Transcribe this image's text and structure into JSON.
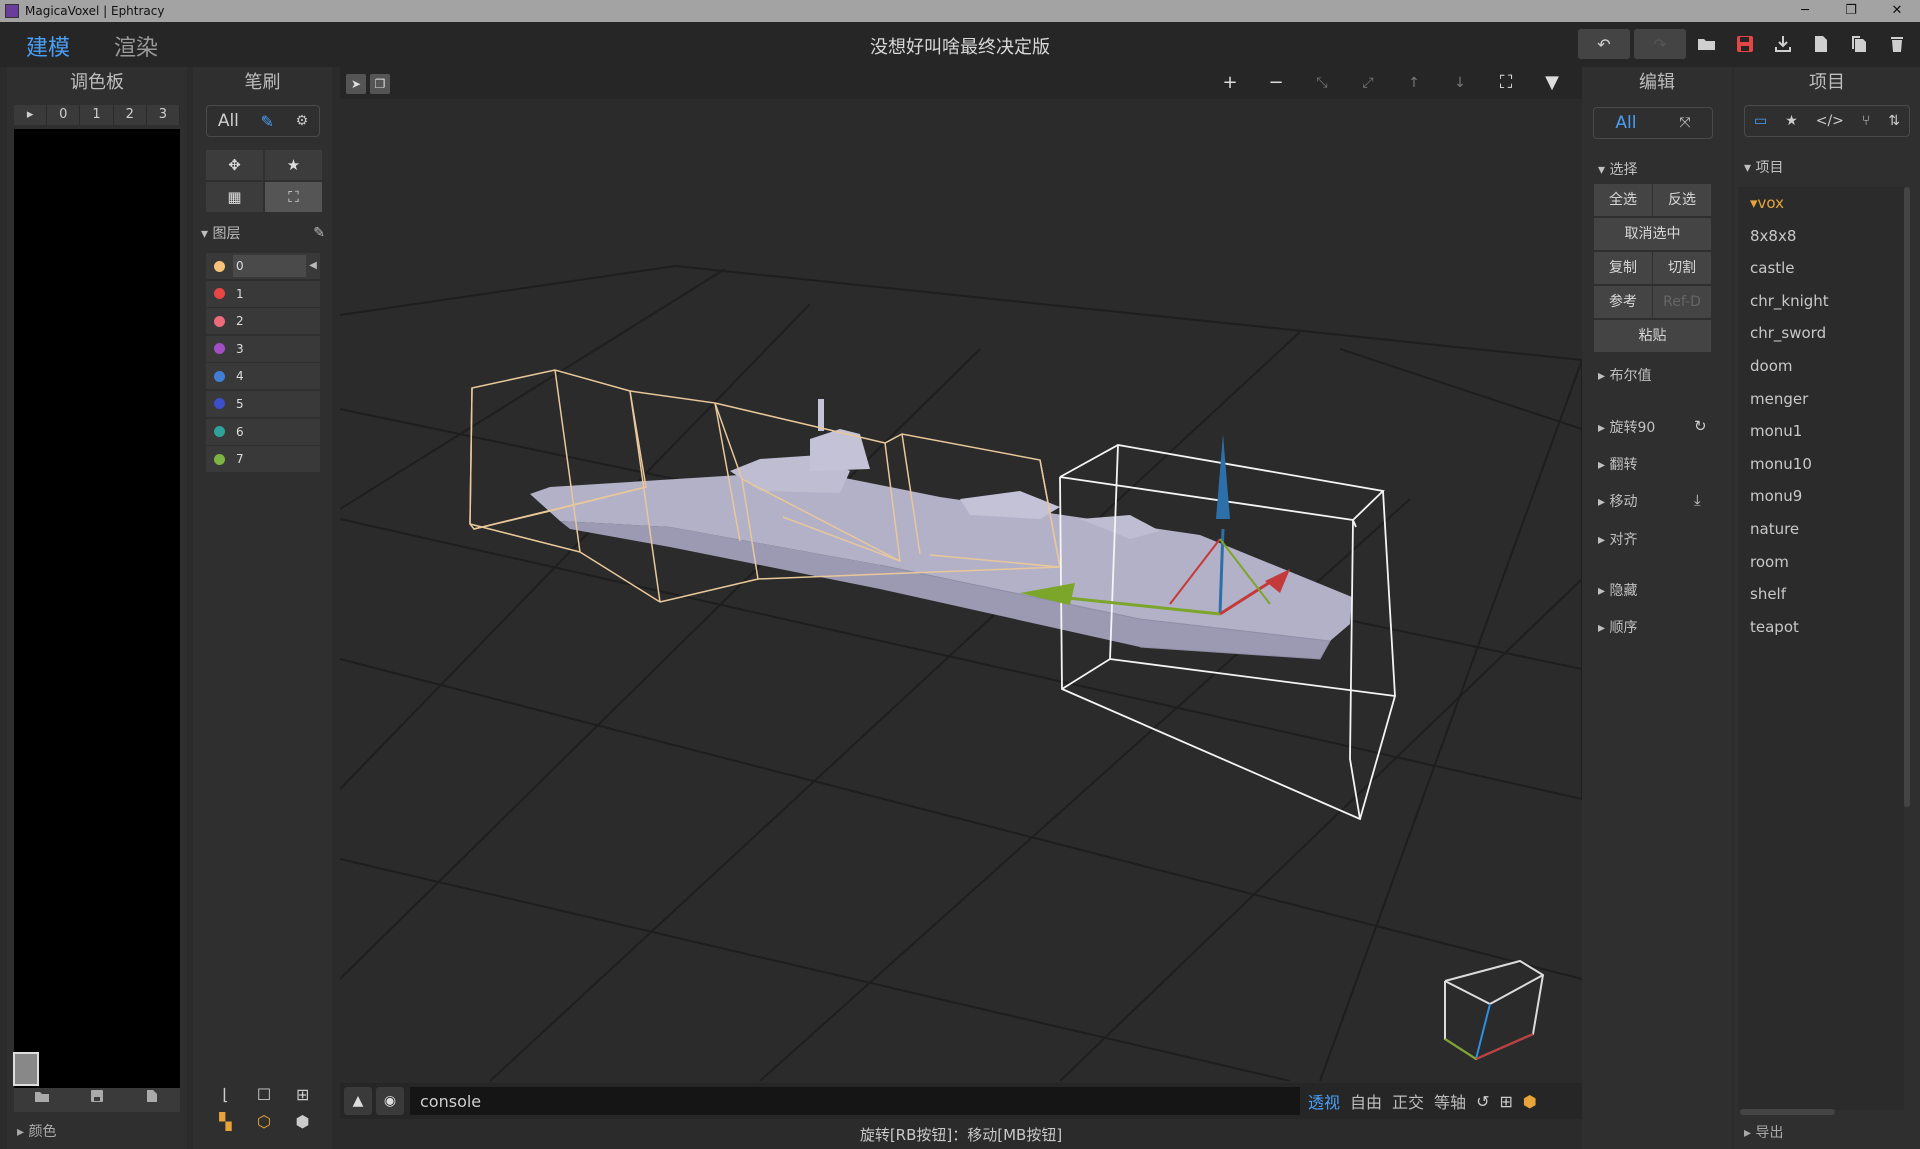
{
  "window": {
    "title": "MagicaVoxel | Ephtracy",
    "min": "─",
    "max": "❐",
    "close": "✕"
  },
  "topbar": {
    "mode_model": "建模",
    "mode_render": "渲染",
    "doc_title": "没想好叫啥最终决定版"
  },
  "palette": {
    "title": "调色板",
    "tabs": [
      "▸",
      "0",
      "1",
      "2",
      "3"
    ],
    "bottom_icons": [
      "open-icon",
      "save-icon",
      "file-icon"
    ],
    "color_section": "颜色"
  },
  "brush": {
    "title": "笔刷",
    "mode_all": "All",
    "layers_title": "图层",
    "layers": [
      {
        "name": "0",
        "color": "#f7c27a",
        "active": true
      },
      {
        "name": "1",
        "color": "#e84545"
      },
      {
        "name": "2",
        "color": "#ec6b7a"
      },
      {
        "name": "3",
        "color": "#a24fc4"
      },
      {
        "name": "4",
        "color": "#3f7fd6"
      },
      {
        "name": "5",
        "color": "#3c4fc8"
      },
      {
        "name": "6",
        "color": "#2ea39a"
      },
      {
        "name": "7",
        "color": "#7cb342"
      }
    ]
  },
  "console": {
    "value": "console"
  },
  "view_modes": [
    "透视",
    "自由",
    "正交",
    "等轴"
  ],
  "status": "旋转[RB按钮]：移动[MB按钮]",
  "edit": {
    "title": "编辑",
    "mode_all": "All",
    "sections": {
      "select": "选择",
      "boolean": "布尔值",
      "rotate90": "旋转90",
      "flip": "翻转",
      "move": "移动",
      "align": "对齐",
      "hide": "隐藏",
      "order": "顺序"
    },
    "buttons": {
      "select_all": "全选",
      "invert": "反选",
      "deselect": "取消选中",
      "copy": "复制",
      "cut": "切割",
      "reference": "参考",
      "ref_d": "Ref-D",
      "paste": "粘贴"
    }
  },
  "project": {
    "title": "项目",
    "section": "项目",
    "folder": "vox",
    "items": [
      "8x8x8",
      "castle",
      "chr_knight",
      "chr_sword",
      "doom",
      "menger",
      "monu1",
      "monu10",
      "monu9",
      "nature",
      "room",
      "shelf",
      "teapot"
    ],
    "export": "导出"
  },
  "colors": {
    "accent": "#4a9ff5",
    "save": "#e64545",
    "folder": "#e6a43a",
    "model": "#b3b1c8"
  }
}
